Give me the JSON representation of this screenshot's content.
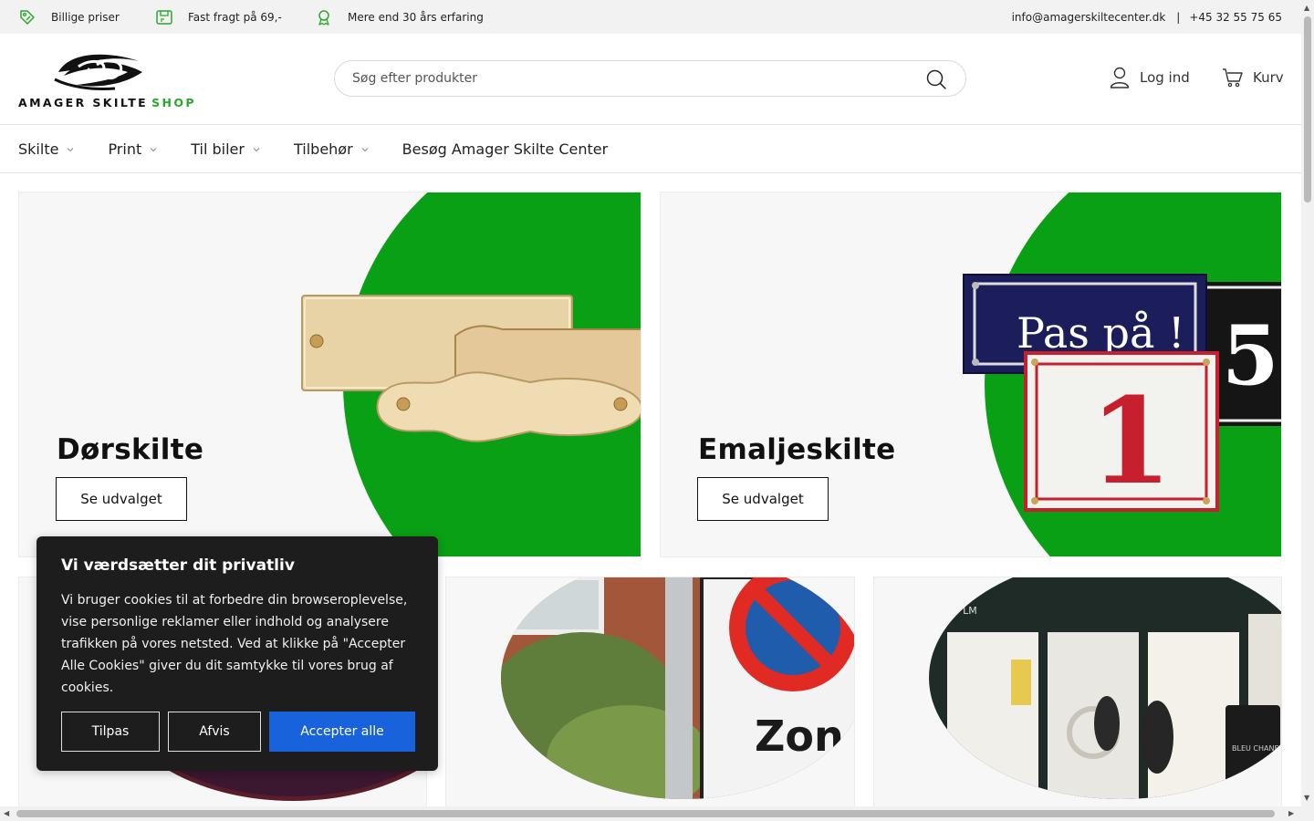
{
  "colors": {
    "accent": "#2aa82a",
    "cookie_primary": "#1863dc",
    "card_green": "#0aa015"
  },
  "topbar": {
    "usps": [
      {
        "icon": "tag-icon",
        "label": "Billige priser"
      },
      {
        "icon": "delivery-icon",
        "label": "Fast fragt på 69,-"
      },
      {
        "icon": "award-icon",
        "label": "Mere end 30 års erfaring"
      }
    ],
    "email": "info@amagerskiltecenter.dk",
    "separator": "|",
    "phone": "+45 32 55 75 65"
  },
  "header": {
    "logo_text": "AMAGER SKILTE",
    "logo_shop": "SHOP",
    "search_placeholder": "Søg efter produkter",
    "login_label": "Log ind",
    "cart_label": "Kurv"
  },
  "nav": {
    "items": [
      {
        "label": "Skilte",
        "dropdown": true
      },
      {
        "label": "Print",
        "dropdown": true
      },
      {
        "label": "Til biler",
        "dropdown": true
      },
      {
        "label": "Tilbehør",
        "dropdown": true
      },
      {
        "label": "Besøg Amager Skilte Center",
        "dropdown": false
      }
    ]
  },
  "cards": [
    {
      "title": "Dørskilte",
      "cta": "Se udvalget"
    },
    {
      "title": "Emaljeskilte",
      "cta": "Se udvalget",
      "sign_text": "Pas på !",
      "sign_number": "1"
    }
  ],
  "small_cards": {
    "zone_text": "Zon",
    "store_text": "LU LM",
    "perfume_text": "BLEU CHANEL"
  },
  "cookie": {
    "title": "Vi værdsætter dit privatliv",
    "text": "Vi bruger cookies til at forbedre din browseroplevelse, vise personlige reklamer eller indhold og analysere trafikken på vores netsted. Ved at klikke på \"Accepter Alle Cookies\" giver du dit samtykke til vores brug af cookies.",
    "customize": "Tilpas",
    "reject": "Afvis",
    "accept": "Accepter alle"
  }
}
